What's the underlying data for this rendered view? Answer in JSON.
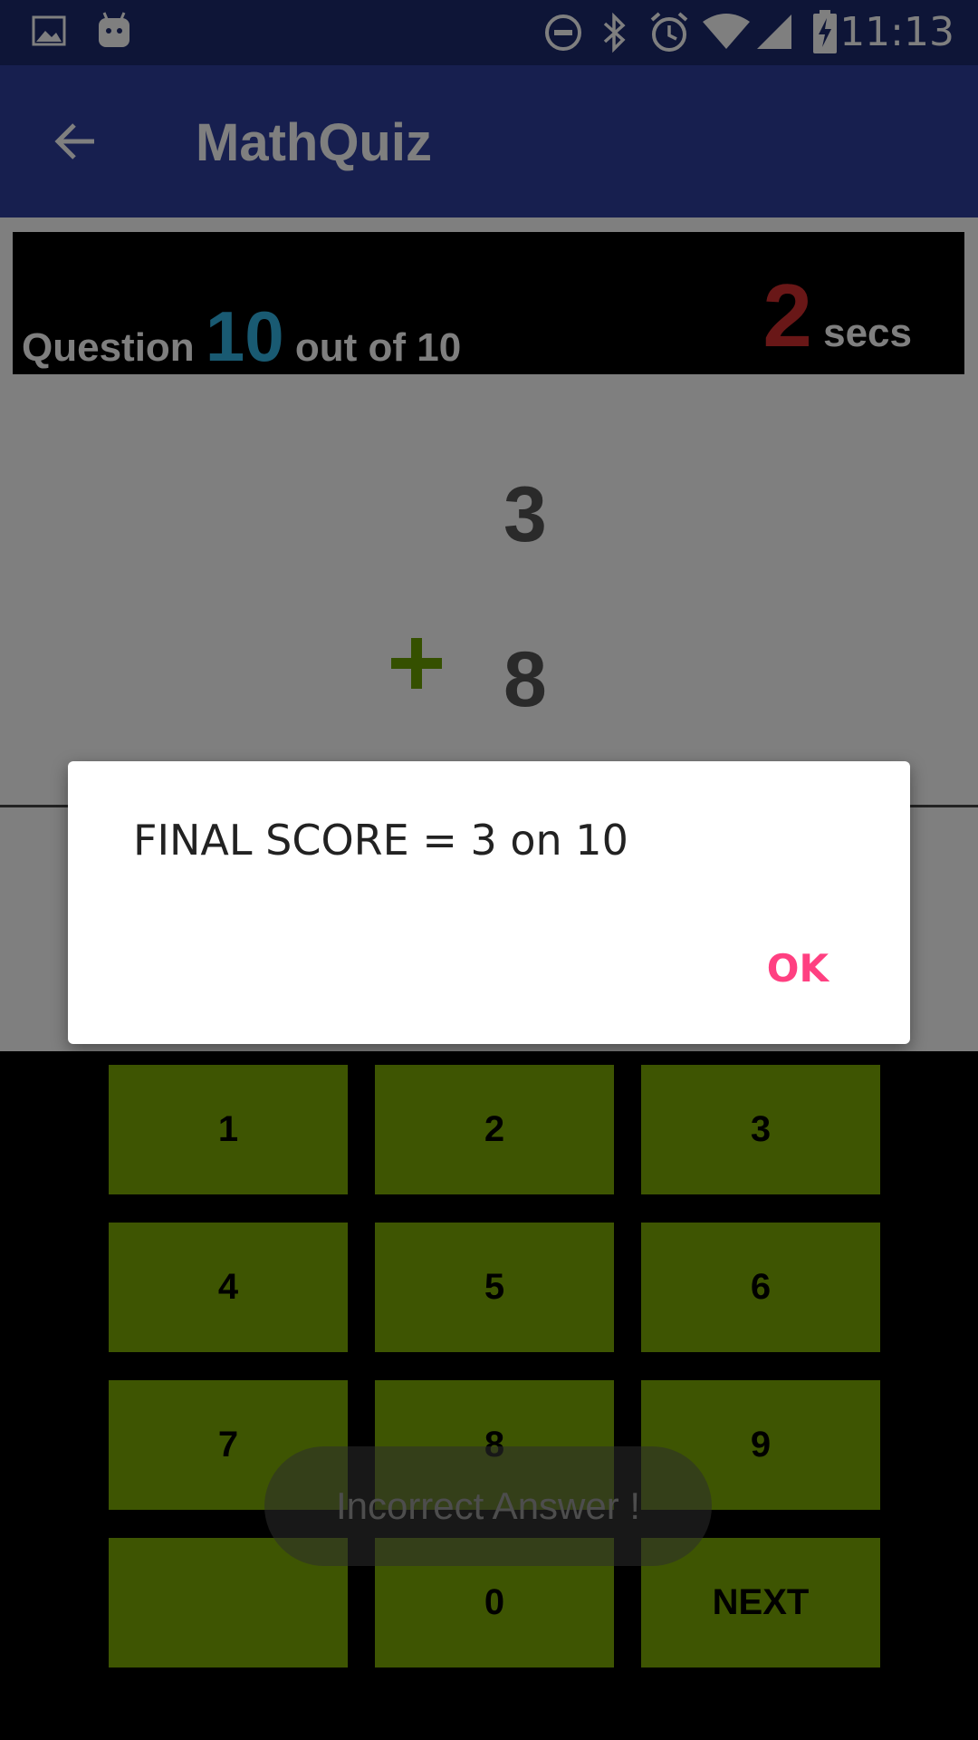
{
  "status_bar": {
    "time": "11:13",
    "icons": [
      "image-icon",
      "android-icon",
      "do-not-disturb-icon",
      "bluetooth-icon",
      "alarm-icon",
      "wifi-icon",
      "signal-icon",
      "battery-charging-icon"
    ]
  },
  "app_bar": {
    "back_icon": "arrow-back-icon",
    "title": "MathQuiz"
  },
  "question_bar": {
    "prefix": "Question",
    "current": "10",
    "suffix": "out of 10",
    "timer_value": "2",
    "timer_unit": "secs"
  },
  "problem": {
    "operand1": "3",
    "operator_icon": "plus-icon",
    "operand2": "8"
  },
  "keypad": {
    "keys": [
      "1",
      "2",
      "3",
      "4",
      "5",
      "6",
      "7",
      "8",
      "9",
      "",
      "0",
      "NEXT"
    ]
  },
  "toast": {
    "text": "Incorrect Answer !"
  },
  "dialog": {
    "message": "FINAL SCORE = 3 on 10",
    "ok_label": "OK"
  },
  "colors": {
    "status_bar": "#1c2a6e",
    "app_bar": "#2f3f9e",
    "question_number": "#33b5e5",
    "timer": "#d32f2f",
    "key": "#7cab05",
    "plus": "#6aa000",
    "dialog_button": "#ff4081"
  }
}
